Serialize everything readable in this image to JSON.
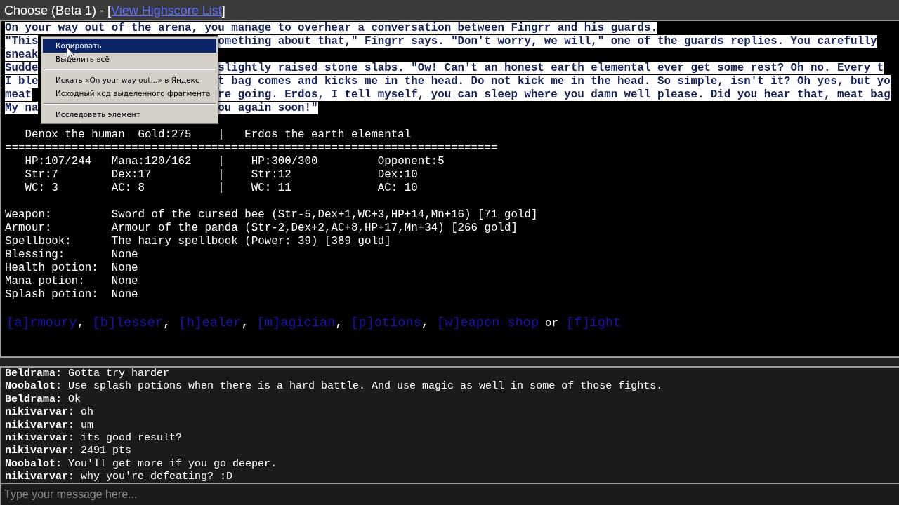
{
  "window": {
    "title": "Choose (Beta 1) - [",
    "title_link": "View Highscore List",
    "title_end": "]"
  },
  "story": {
    "selected": true,
    "lines": [
      {
        "left": "On your way out of the arena, you manage to overhear a conversation between Fingrr and his guards."
      },
      {
        "left": "\"This",
        "right": "omething about that,\" Fingrr says. \"Don't worry, we will,\" one of the guards replies. You carefully"
      },
      {
        "left": "sneak"
      },
      {
        "left": "Sudde",
        "right": "slightly raised stone slabs. \"Ow! Can't an honest earth elemental ever get some rest? Oh no. Every t"
      },
      {
        "left": "I ble",
        "right": "t bag comes and kicks me in the head. Do not kick me in the head. So simple, isn't it? Oh yes, but yo"
      },
      {
        "left": "meat",
        "right": "re going. Erdos, I tell myself, you can sleep where you damn well please. Did you hear that, meat bag"
      },
      {
        "left": "My na",
        "right": "ou again soon!\""
      }
    ]
  },
  "context_menu": {
    "items": [
      {
        "label": "Копировать",
        "selected": true
      },
      {
        "label": "Выделить всё",
        "selected": false,
        "separator_after": true
      },
      {
        "label": "Искать «On your way out...» в Яндекс",
        "selected": false
      },
      {
        "label": "Исходный код выделенного фрагмента",
        "selected": false,
        "separator_after": true
      },
      {
        "label": "Исследовать элемент",
        "selected": false
      }
    ]
  },
  "stats": [
    "   Denox the human  Gold:275    |   Erdos the earth elemental",
    "==========================================================================",
    "   HP:107/244   Mana:120/162    |    HP:300/300         Opponent:5",
    "   Str:7        Dex:17          |    Str:12             Dex:10",
    "   WC: 3        AC: 8           |    WC: 11             AC: 10"
  ],
  "equipment": [
    {
      "label": "Weapon:",
      "value": "Sword of the cursed bee (Str-5,Dex+1,WC+3,HP+14,Mn+16) [71 gold]"
    },
    {
      "label": "Armour:",
      "value": "Armour of the panda (Str-2,Dex+2,AC+8,HP+17,Mn+34) [266 gold]"
    },
    {
      "label": "Spellbook:",
      "value": "The hairy spellbook (Power: 39) [389 gold]"
    },
    {
      "label": "Blessing:",
      "value": "None"
    },
    {
      "label": "Health potion:",
      "value": "None"
    },
    {
      "label": "Mana potion:",
      "value": "None"
    },
    {
      "label": "Splash potion:",
      "value": "None"
    }
  ],
  "commands": [
    {
      "label": "[a]rmoury",
      "after": ","
    },
    {
      "label": "[b]lesser",
      "after": ","
    },
    {
      "label": "[h]ealer",
      "after": ","
    },
    {
      "label": "[m]agician",
      "after": ","
    },
    {
      "label": "[p]otions",
      "after": ","
    },
    {
      "label": "[w]eapon shop",
      "after": "or"
    },
    {
      "label": "[f]ight"
    }
  ],
  "chat": [
    {
      "name": "Beldrama:",
      "text": "Gotta try harder"
    },
    {
      "name": "Noobalot:",
      "text": "Use splash potions when there is a hard battle. And use magic as well in some of those fights."
    },
    {
      "name": "Beldrama:",
      "text": "Ok"
    },
    {
      "name": "nikivarvar:",
      "text": "oh"
    },
    {
      "name": "nikivarvar:",
      "text": "um"
    },
    {
      "name": "nikivarvar:",
      "text": "its good result?"
    },
    {
      "name": "nikivarvar:",
      "text": "2491 pts"
    },
    {
      "name": "Noobalot:",
      "text": "You'll get more if you go deeper."
    },
    {
      "name": "nikivarvar:",
      "text": "why you're defeating? :D"
    }
  ],
  "message_input": {
    "placeholder": "Type your message here..."
  }
}
